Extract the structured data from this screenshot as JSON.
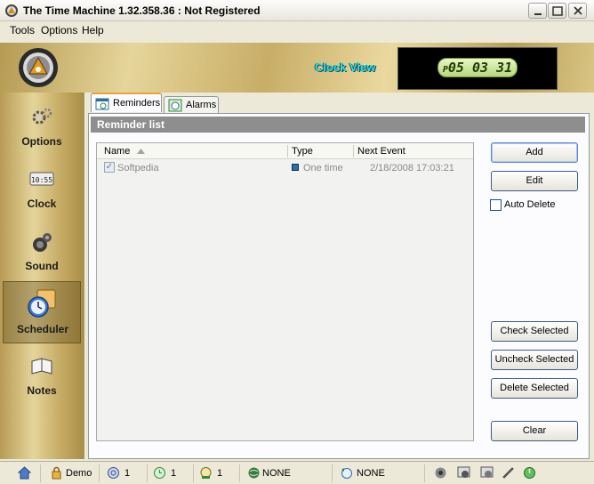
{
  "window": {
    "title": "The Time Machine 1.32.358.36 :  Not Registered"
  },
  "menu": [
    "Tools",
    "Options",
    "Help"
  ],
  "header": {
    "clock_view_label": "Clock View",
    "display": {
      "prefix": "P",
      "time": "05 03 31"
    }
  },
  "sidebar": {
    "items": [
      {
        "label": "Options",
        "icon": "gears-icon"
      },
      {
        "label": "Clock",
        "icon": "digital-clock-icon"
      },
      {
        "label": "Sound",
        "icon": "speaker-icon"
      },
      {
        "label": "Scheduler",
        "icon": "alarm-clock-icon",
        "active": true
      },
      {
        "label": "Notes",
        "icon": "book-icon"
      }
    ]
  },
  "tabs": [
    {
      "label": "Reminders",
      "icon": "calendar-icon",
      "active": true
    },
    {
      "label": "Alarms",
      "icon": "alarm-icon",
      "active": false
    }
  ],
  "reminder_list": {
    "header": "Reminder list",
    "columns": [
      "Name",
      "Type",
      "Next Event"
    ],
    "rows": [
      {
        "checked": true,
        "name": "Softpedia",
        "type": "One time",
        "next_event": "2/18/2008 17:03:21"
      }
    ]
  },
  "buttons": {
    "add": "Add",
    "edit": "Edit",
    "auto_delete": "Auto Delete",
    "check_selected": "Check Selected",
    "uncheck_selected": "Uncheck Selected",
    "delete_selected": "Delete Selected",
    "clear": "Clear"
  },
  "statusbar": {
    "mode": "Demo",
    "reminders_count": "1",
    "alarms_count": "1",
    "timers_count": "1",
    "network_status": "NONE",
    "sync_status": "NONE"
  },
  "colors": {
    "accent_cyan": "#33e5e5",
    "lcd_green": "#b5d77c",
    "gold": "#d4bd7a"
  }
}
